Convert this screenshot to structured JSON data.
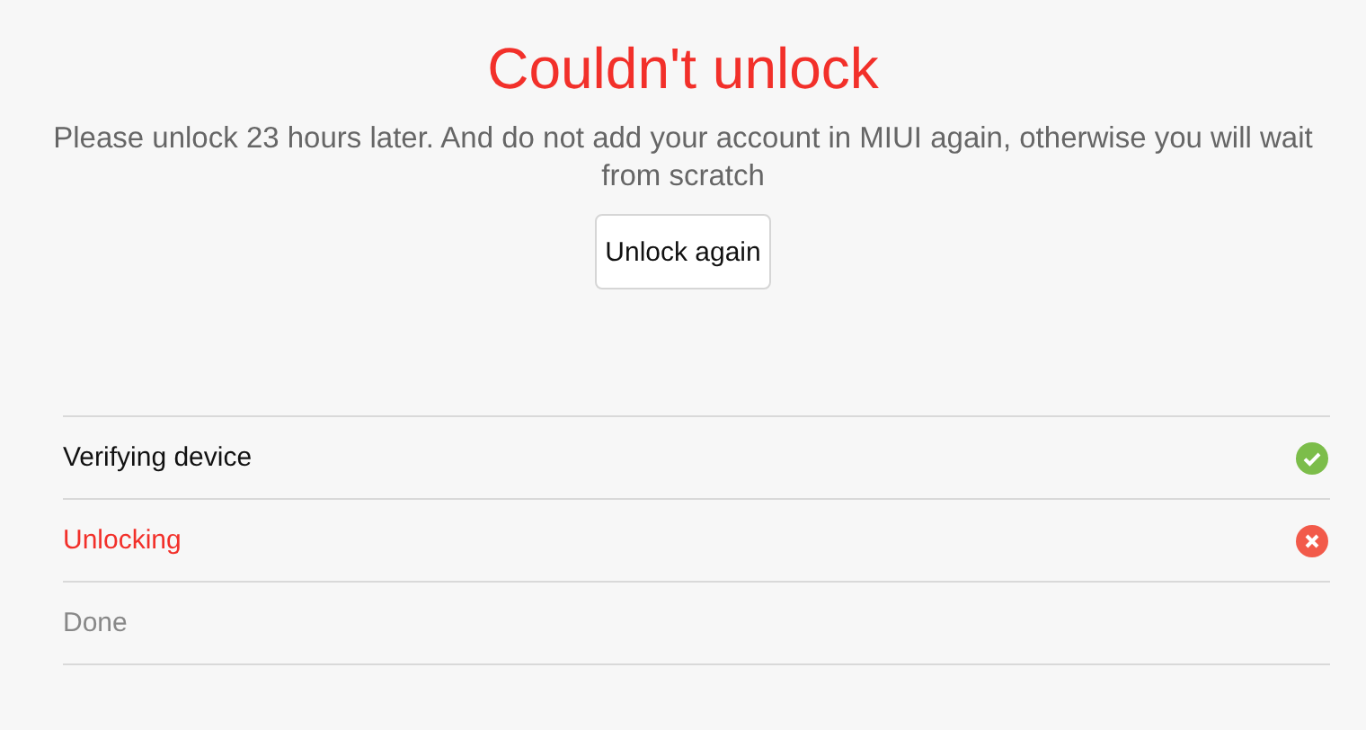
{
  "title": "Couldn't unlock",
  "message": "Please unlock 23 hours later. And do not add your account in MIUI again, otherwise you will wait from scratch",
  "button": "Unlock again",
  "steps": [
    {
      "label": "Verifying device",
      "kind": "done"
    },
    {
      "label": "Unlocking",
      "kind": "failed"
    },
    {
      "label": "Done",
      "kind": "pending"
    }
  ]
}
